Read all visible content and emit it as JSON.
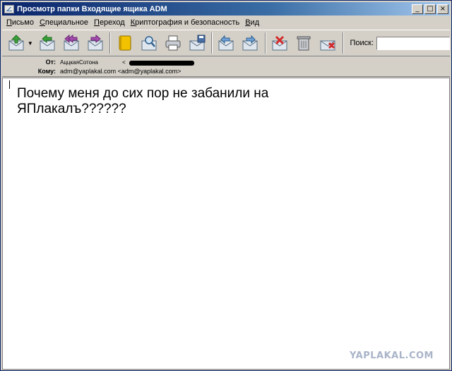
{
  "window": {
    "title": "Просмотр папки Входящие ящика ADM",
    "buttons": {
      "minimize": "_",
      "maximize": "□",
      "close": "×"
    }
  },
  "menubar": [
    {
      "hotkey": "П",
      "rest": "исьмо"
    },
    {
      "hotkey": "С",
      "rest": "пециальное"
    },
    {
      "hotkey": "П",
      "rest": "ереход"
    },
    {
      "hotkey": "К",
      "rest": "риптография и безопасность"
    },
    {
      "hotkey": "В",
      "rest": "ид"
    }
  ],
  "toolbar": {
    "icons": [
      "get-mail-icon",
      "reply-icon",
      "reply-all-icon",
      "forward-icon",
      "address-book-icon",
      "find-icon",
      "print-icon",
      "save-icon",
      "previous-message-icon",
      "next-message-icon",
      "delete-icon",
      "trash-can-icon",
      "junk-icon"
    ],
    "search_label": "Поиск:",
    "search_value": ""
  },
  "header": {
    "from_label": "От:",
    "from_name": "АццкаяСотона",
    "from_email_prefix": "<",
    "to_label": "Кому:",
    "to_value": "adm@yaplakal.com <adm@yaplakal.com>"
  },
  "message": {
    "body": "Почему меня до сих пор не забанили на ЯПлакалъ??????"
  },
  "watermark": "YAPLAKAL.COM",
  "colors": {
    "titlebar_start": "#0a246a",
    "titlebar_end": "#a6caf0",
    "chrome": "#d4d0c8"
  }
}
